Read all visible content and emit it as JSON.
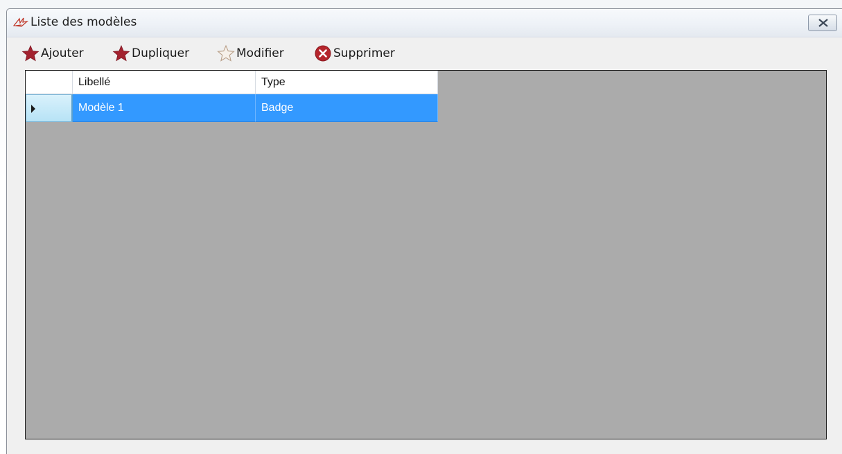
{
  "window": {
    "title": "Liste des modèles",
    "title_icon": "app-logo-icon",
    "close_icon": "close-icon"
  },
  "toolbar": {
    "items": [
      {
        "label": "Ajouter",
        "icon": "star-red-icon"
      },
      {
        "label": "Dupliquer",
        "icon": "star-red-icon"
      },
      {
        "label": "Modifier",
        "icon": "star-outline-icon"
      },
      {
        "label": "Supprimer",
        "icon": "delete-x-circle-icon"
      }
    ]
  },
  "grid": {
    "columns": [
      "Libellé",
      "Type"
    ],
    "rows": [
      {
        "libelle": "Modèle 1",
        "type": "Badge",
        "selected": true
      }
    ],
    "colors": {
      "background": "#ababab",
      "selection": "#3399ff",
      "selection_text": "#ffffff"
    }
  },
  "colors": {
    "accent_red": "#a3222f",
    "delete_red": "#b5252c"
  }
}
